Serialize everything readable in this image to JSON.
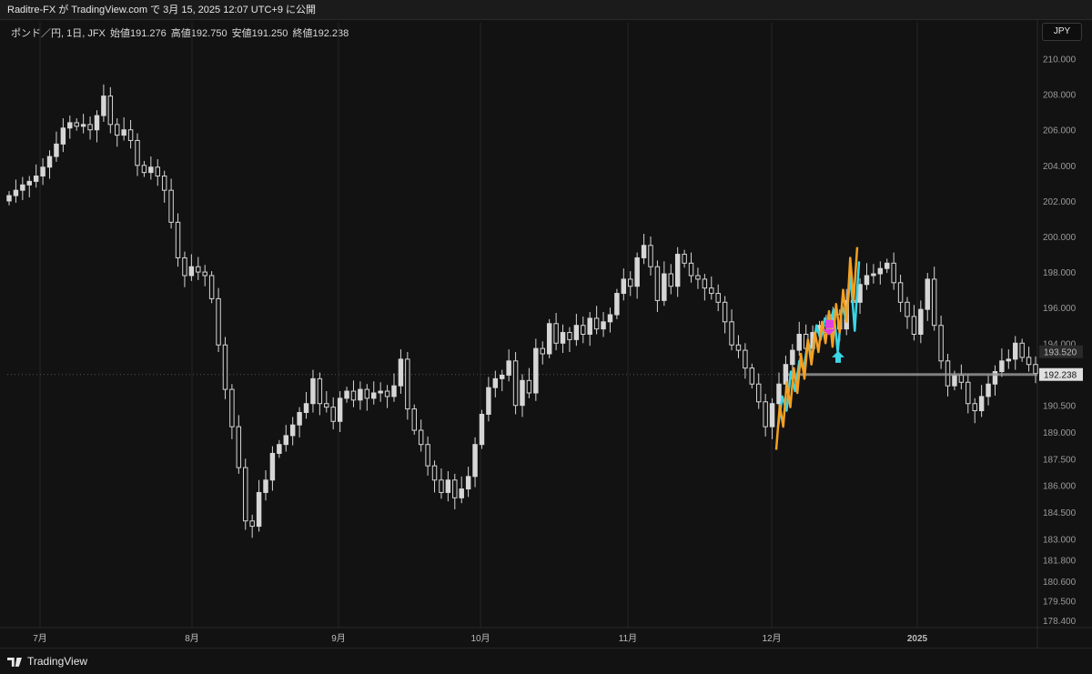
{
  "header": {
    "publish_line": "Raditre-FX が TradingView.com で 3月 15, 2025 12:07 UTC+9 に公開"
  },
  "legend": {
    "symbol": "ポンド／円, 1日, JFX",
    "open": "始値191.276",
    "high": "高値192.750",
    "low": "安値191.250",
    "close": "終値192.238"
  },
  "currency_button": "JPY",
  "footer": {
    "brand": "TradingView"
  },
  "colors": {
    "background": "#121212",
    "candle": "#d6d6d6",
    "indicator_orange": "#f5a020",
    "indicator_cyan": "#3ad6e6",
    "marker_magenta": "#e040e0",
    "price_line": "#9a9a9a"
  },
  "chart_data": {
    "type": "candlestick",
    "y_axis_labels": [
      "210.000",
      "208.000",
      "206.000",
      "204.000",
      "202.000",
      "200.000",
      "198.000",
      "196.000",
      "194.000",
      "192.238",
      "190.500",
      "189.000",
      "187.500",
      "186.000",
      "184.500",
      "183.000",
      "181.800",
      "180.600",
      "179.500",
      "178.400"
    ],
    "ylim": [
      178.0,
      211.0
    ],
    "x_axis_labels": [
      "7月",
      "8月",
      "9月",
      "10月",
      "11月",
      "12月",
      "2025"
    ],
    "price_labels": {
      "last": "192.238",
      "marker": "193.520"
    },
    "last_price": 192.238,
    "marker_price": 193.52,
    "closes": [
      202.3,
      202.6,
      202.9,
      203.1,
      203.4,
      203.9,
      204.5,
      205.2,
      206.1,
      206.4,
      206.2,
      206.3,
      206.0,
      206.8,
      207.9,
      206.3,
      205.7,
      206.0,
      205.4,
      204.0,
      203.6,
      203.9,
      203.4,
      202.6,
      200.8,
      198.8,
      197.8,
      198.3,
      198.0,
      197.8,
      196.5,
      193.9,
      191.4,
      189.3,
      187.0,
      184.0,
      183.7,
      185.6,
      186.3,
      187.8,
      188.3,
      188.8,
      189.4,
      190.1,
      190.6,
      192.0,
      190.6,
      190.4,
      189.6,
      190.9,
      191.3,
      190.8,
      191.4,
      190.9,
      191.2,
      191.3,
      191.0,
      191.6,
      193.1,
      190.3,
      189.1,
      188.3,
      187.1,
      186.3,
      185.6,
      186.3,
      185.3,
      185.8,
      186.5,
      188.3,
      190.0,
      191.5,
      192.0,
      192.2,
      193.0,
      190.5,
      191.9,
      191.2,
      193.7,
      193.4,
      195.1,
      194.0,
      194.6,
      194.2,
      195.0,
      194.5,
      195.4,
      194.8,
      195.2,
      195.6,
      196.8,
      197.6,
      197.2,
      198.8,
      199.5,
      198.3,
      196.4,
      197.9,
      197.2,
      199.0,
      198.5,
      197.8,
      197.6,
      197.1,
      196.8,
      196.3,
      195.2,
      193.9,
      193.6,
      192.6,
      191.7,
      190.7,
      189.3,
      190.6,
      191.7,
      192.8,
      193.6,
      194.5,
      193.7,
      194.6,
      195.0,
      194.6,
      195.6,
      194.8,
      196.4,
      196.3,
      197.3,
      197.8,
      197.9,
      198.2,
      198.5,
      197.4,
      196.3,
      195.5,
      194.5,
      195.9,
      197.6,
      195.0,
      193.0,
      191.6,
      192.2,
      191.8,
      190.6,
      190.2,
      191.0,
      191.7,
      192.4,
      193.0,
      193.1,
      194.0,
      193.2,
      192.8,
      192.3
    ],
    "indicator_orange": [
      188.0,
      190.5,
      189.3,
      191.8,
      190.4,
      192.6,
      191.2,
      193.4,
      192.0,
      194.2,
      192.8,
      194.6,
      193.5,
      195.2,
      194.0,
      195.8,
      193.8,
      196.2,
      194.6,
      197.0,
      195.2,
      198.8,
      196.4,
      199.4
    ],
    "indicator_cyan": [
      189.3,
      191.0,
      190.2,
      192.4,
      191.3,
      193.0,
      192.5,
      194.1,
      193.2,
      195.0,
      194.2,
      195.4,
      194.8,
      195.9,
      193.5,
      196.1,
      195.3,
      197.8,
      194.7,
      198.6
    ],
    "markers": [
      {
        "type": "sell-square",
        "price": 195.0
      },
      {
        "type": "buy-arrow",
        "price": 193.2
      }
    ]
  }
}
